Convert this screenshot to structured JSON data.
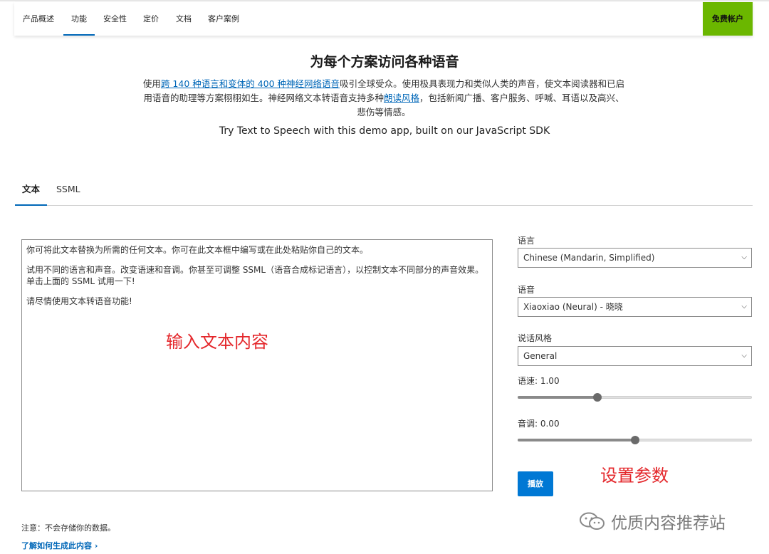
{
  "nav": {
    "items": [
      "产品概述",
      "功能",
      "安全性",
      "定价",
      "文档",
      "客户案例"
    ],
    "active_index": 1,
    "free_account": "免费帐户"
  },
  "header": {
    "title": "为每个方案访问各种语音",
    "desc_prefix": "使用",
    "desc_link1": "跨 140 种语言和变体的 400 种神经网络语音",
    "desc_mid": "吸引全球受众。使用极具表现力和类似人类的声音，使文本阅读器和已启用语音的助理等方案栩栩如生。神经网络文本转语音支持多种",
    "desc_link2": "朗读风格",
    "desc_suffix": "，包括新闻广播、客户服务、呼喊、耳语以及高兴、悲伤等情感。",
    "demo_line": "Try Text to Speech with this demo app, built on our JavaScript SDK"
  },
  "tabs": {
    "items": [
      "文本",
      "SSML"
    ],
    "active_index": 0
  },
  "editor": {
    "paragraphs": [
      "你可将此文本替换为所需的任何文本。你可在此文本框中编写或在此处粘贴你自己的文本。",
      "试用不同的语言和声音。改变语速和音调。你甚至可调整 SSML（语音合成标记语言），以控制文本不同部分的声音效果。单击上面的 SSML 试用一下!",
      "请尽情使用文本转语音功能!"
    ],
    "overlay": "输入文本内容"
  },
  "settings": {
    "language_label": "语言",
    "language_value": "Chinese (Mandarin, Simplified)",
    "voice_label": "语音",
    "voice_value": "Xiaoxiao (Neural) - 晓晓",
    "style_label": "说话风格",
    "style_value": "General",
    "rate_label": "语速: 1.00",
    "rate_fraction": 0.34,
    "pitch_label": "音调: 0.00",
    "pitch_fraction": 0.5,
    "overlay": "设置参数",
    "play": "播放"
  },
  "footer": {
    "note": "注意：不会存储你的数据。",
    "learn_more": "了解如何生成此内容",
    "learn_more_chevron": "›"
  },
  "watermark": {
    "text": "优质内容推荐站",
    "icon": "wechat-icon"
  },
  "colors": {
    "accent": "#0067b8",
    "button": "#0078d4",
    "free_button": "#6bb700",
    "overlay_red": "#e4272b"
  }
}
